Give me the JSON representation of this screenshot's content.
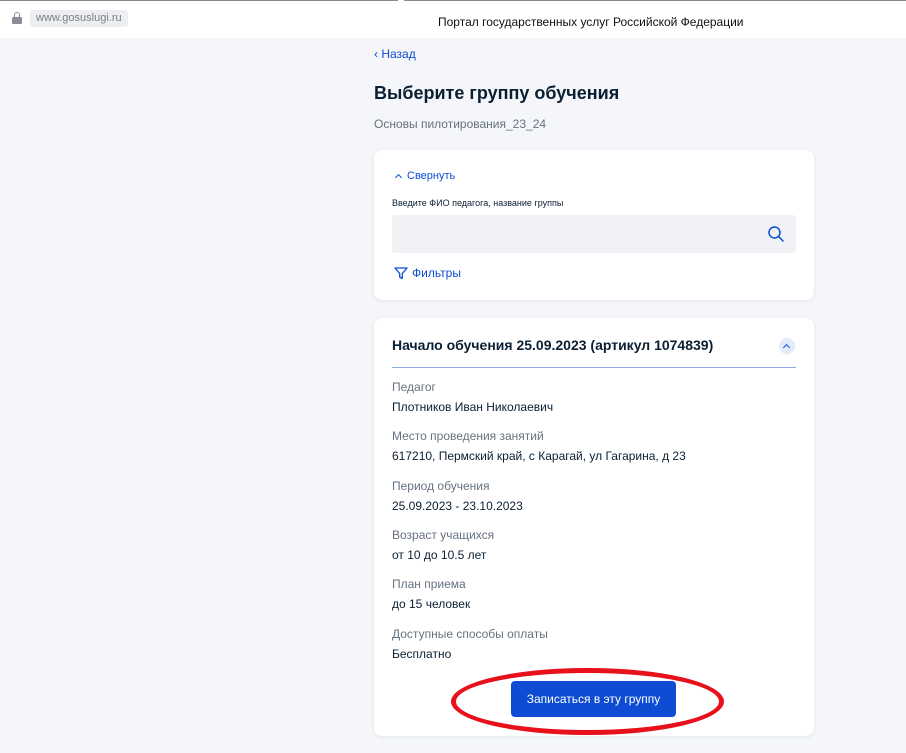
{
  "browser": {
    "url": "www.gosuslugi.ru",
    "page_title": "Портал государственных услуг Российской Федерации"
  },
  "nav": {
    "back_label": "‹ Назад"
  },
  "page": {
    "title": "Выберите группу обучения",
    "subtitle": "Основы пилотирования_23_24"
  },
  "search": {
    "collapse_label": "Свернуть",
    "field_label": "Введите ФИО педагога, название группы",
    "value": "",
    "placeholder": "",
    "filters_label": "Фильтры"
  },
  "group": {
    "title": "Начало обучения 25.09.2023 (артикул 1074839)",
    "fields": [
      {
        "label": "Педагог",
        "value": "Плотников Иван Николаевич"
      },
      {
        "label": "Место проведения занятий",
        "value": "617210, Пермский край, с Карагай, ул Гагарина, д 23"
      },
      {
        "label": "Период обучения",
        "value": "25.09.2023 - 23.10.2023"
      },
      {
        "label": "Возраст учащихся",
        "value": "от 10 до 10.5 лет"
      },
      {
        "label": "План приема",
        "value": "до 15 человек"
      },
      {
        "label": "Доступные способы оплаты",
        "value": "Бесплатно"
      }
    ],
    "submit_label": "Записаться в эту группу"
  },
  "colors": {
    "accent": "#0d4cd3",
    "annotation": "#e8101a",
    "text": "#0b1f33",
    "muted": "#66727f"
  }
}
